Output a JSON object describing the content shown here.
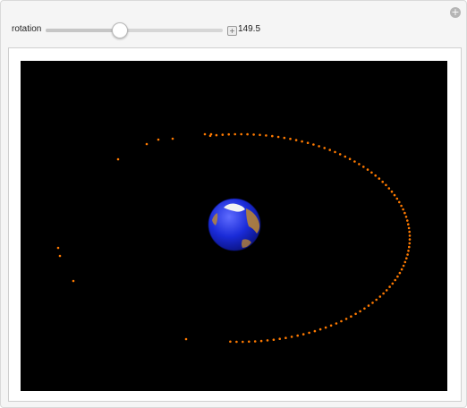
{
  "controls": {
    "slider_label": "rotation",
    "slider_value": "149.5",
    "slider_fraction": 0.42,
    "expand_symbol": "+",
    "corner_symbol": "+"
  },
  "scene": {
    "background": "#000000",
    "orbit_color": "#ff7a00",
    "earth_ocean_color": "#1a2bd8",
    "earth_land_color": "#c08a30",
    "earth_ice_color": "#f2f2f2"
  }
}
